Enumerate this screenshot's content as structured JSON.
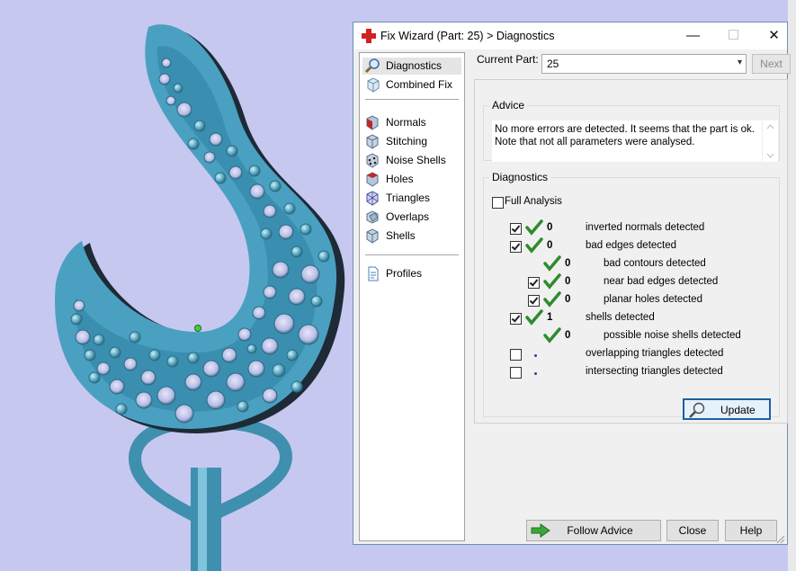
{
  "dialog": {
    "title": "Fix Wizard (Part: 25) > Diagnostics",
    "minimize_glyph": "—",
    "maximize_glyph": "☐",
    "close_glyph": "✕"
  },
  "nav": {
    "items": [
      {
        "label": "Diagnostics",
        "icon": "magnifier-icon",
        "selected": true
      },
      {
        "label": "Combined Fix",
        "icon": "cube-icon"
      },
      {
        "label": "Normals",
        "icon": "normals-cube-icon"
      },
      {
        "label": "Stitching",
        "icon": "stitching-cube-icon"
      },
      {
        "label": "Noise Shells",
        "icon": "noise-shells-icon"
      },
      {
        "label": "Holes",
        "icon": "holes-cube-icon"
      },
      {
        "label": "Triangles",
        "icon": "triangles-cube-icon"
      },
      {
        "label": "Overlaps",
        "icon": "overlaps-icon"
      },
      {
        "label": "Shells",
        "icon": "shells-icon"
      },
      {
        "label": "Profiles",
        "icon": "document-icon"
      }
    ]
  },
  "current_part": {
    "label": "Current Part:",
    "value": "25",
    "next_label": "Next"
  },
  "advice": {
    "legend": "Advice",
    "line1": "No more errors are detected. It seems that the part is ok.",
    "line2": "Note that not all parameters were analysed."
  },
  "diagnostics": {
    "legend": "Diagnostics",
    "full_analysis_label": "Full Analysis",
    "full_analysis_checked": false,
    "rows": [
      {
        "count": "0",
        "label": "inverted normals detected",
        "checked": true,
        "status": "ok"
      },
      {
        "count": "0",
        "label": "bad edges detected",
        "checked": true,
        "status": "ok"
      },
      {
        "count": "0",
        "label": "bad contours detected",
        "status": "ok"
      },
      {
        "count": "0",
        "label": "near bad edges detected",
        "checked": true,
        "status": "ok"
      },
      {
        "count": "0",
        "label": "planar holes detected",
        "checked": true,
        "status": "ok"
      },
      {
        "count": "1",
        "label": "shells detected",
        "checked": true,
        "status": "ok"
      },
      {
        "count": "0",
        "label": "possible noise shells detected",
        "status": "ok"
      },
      {
        "count": "",
        "label": "overlapping triangles detected",
        "checked": false,
        "status": "not-run"
      },
      {
        "count": "",
        "label": "intersecting triangles detected",
        "checked": false,
        "status": "not-run"
      }
    ],
    "update_label": "Update"
  },
  "buttons": {
    "follow_advice": "Follow Advice",
    "close": "Close",
    "help": "Help"
  },
  "colors": {
    "background": "#c6c8f0",
    "model": "#4fa3c2",
    "check_green": "#2e8b2e",
    "title_cross": "#d32020",
    "accent": "#1f5fa0"
  }
}
